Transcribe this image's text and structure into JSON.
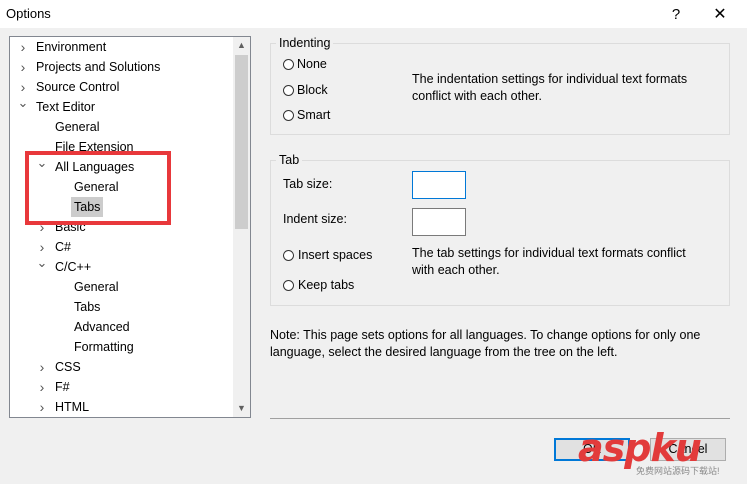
{
  "window": {
    "title": "Options",
    "help_glyph": "?",
    "close_glyph": "✕"
  },
  "tree": {
    "items": [
      {
        "label": "Environment",
        "chevron": "right"
      },
      {
        "label": "Projects and Solutions",
        "chevron": "right"
      },
      {
        "label": "Source Control",
        "chevron": "right"
      },
      {
        "label": "Text Editor",
        "chevron": "down"
      },
      {
        "label": "General",
        "chevron": "none"
      },
      {
        "label": "File Extension",
        "chevron": "none"
      },
      {
        "label": "All Languages",
        "chevron": "down"
      },
      {
        "label": "General",
        "chevron": "none"
      },
      {
        "label": "Tabs",
        "chevron": "none",
        "selected": true
      },
      {
        "label": "Basic",
        "chevron": "right"
      },
      {
        "label": "C#",
        "chevron": "right"
      },
      {
        "label": "C/C++",
        "chevron": "down"
      },
      {
        "label": "General",
        "chevron": "none"
      },
      {
        "label": "Tabs",
        "chevron": "none"
      },
      {
        "label": "Advanced",
        "chevron": "none"
      },
      {
        "label": "Formatting",
        "chevron": "none"
      },
      {
        "label": "CSS",
        "chevron": "right"
      },
      {
        "label": "F#",
        "chevron": "right"
      },
      {
        "label": "HTML",
        "chevron": "right"
      }
    ]
  },
  "indenting": {
    "title": "Indenting",
    "options": [
      "None",
      "Block",
      "Smart"
    ],
    "conflict_text": "The indentation settings for individual text formats conflict with each other."
  },
  "tab": {
    "title": "Tab",
    "tab_size_label": "Tab size:",
    "tab_size_value": "",
    "indent_size_label": "Indent size:",
    "indent_size_value": "",
    "insert_spaces_label": "Insert spaces",
    "keep_tabs_label": "Keep tabs",
    "conflict_text": "The tab settings for individual text formats conflict with each other."
  },
  "note": "Note: This page sets options for all languages. To change options for only one language, select the desired language from the tree on the left.",
  "buttons": {
    "ok": "OK",
    "cancel": "Cancel"
  },
  "watermark": {
    "brand": "aspku",
    "sub": "免费网站源码下载站!"
  },
  "colors": {
    "annotation": "#e8383b",
    "focus": "#0078d7",
    "selection": "#cccccc"
  }
}
